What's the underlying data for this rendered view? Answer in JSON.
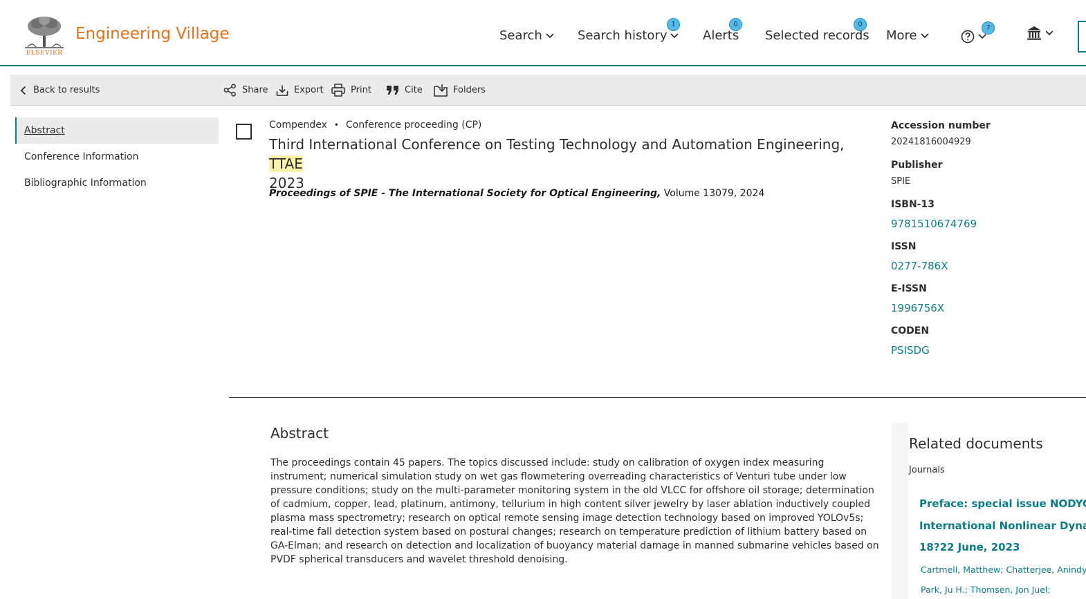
{
  "header": {
    "logo_text": "ELSEVIER",
    "brand": "Engineering Village",
    "nav": [
      {
        "label": "Search",
        "badge": ""
      },
      {
        "label": "Search history",
        "badge": "1"
      },
      {
        "label": "Alerts",
        "badge": "0"
      },
      {
        "label": "Selected records",
        "badge": "0"
      },
      {
        "label": "More",
        "badge": ""
      },
      {
        "label": "",
        "badge": "7"
      }
    ]
  },
  "toolbar": {
    "back": "Back to results",
    "share": "Share",
    "export": "Export",
    "print": "Print",
    "cite": "Cite",
    "folders": "Folders"
  },
  "sidebar": {
    "items": [
      {
        "label": "Abstract"
      },
      {
        "label": "Conference Information"
      },
      {
        "label": "Bibliographic Information"
      }
    ]
  },
  "record": {
    "database": "Compendex",
    "doc_type": "Conference proceeding (CP)",
    "title_main": "Third International Conference on Testing Technology and Automation Engineering, ",
    "title_highlight": "TTAE",
    "title_end": "2023",
    "source_publication": "Proceedings of SPIE - The International Society for Optical Engineering,",
    "source_rest": " Volume 13079, 2024"
  },
  "details": {
    "accession_label": "Accession number",
    "accession_value": "20241816004929",
    "publisher_label": "Publisher",
    "publisher_value": "SPIE",
    "isbn_label": "ISBN-13",
    "isbn_value": "9781510674769",
    "issn_label": "ISSN",
    "issn_value": "0277-786X",
    "eissn_label": "E-ISSN",
    "eissn_value": "1996756X",
    "coden_label": "CODEN",
    "coden_value": "PSISDG"
  },
  "abstract": {
    "heading": "Abstract",
    "body": "The proceedings contain 45 papers. The topics discussed include: study on calibration of oxygen index measuring instrument; numerical simulation study on wet gas flowmetering overreading characteristics of Venturi tube under low pressure conditions; study on the multi-parameter monitoring system in the old VLCC for offshore oil storage; determination of cadmium, copper, lead, platinum, antimony, tellurium in high content silver jewelry by laser ablation inductively coupled plasma mass spectrometry; research on optical remote sensing image detection technology based on improved YOLOv5s; real-time fall detection system based on postural changes; research on temperature prediction of lithium battery based on GA-Elman; and research on detection and localization of buoyancy material damage in manned submarine vehicles based on PVDF spherical transducers and wavelet threshold denoising."
  },
  "related": {
    "heading": "Related documents",
    "subheading": "Journals",
    "doc_title_line1": "Preface: special issue NODYCON",
    "doc_title_line2": "International Nonlinear Dynam",
    "doc_title_line3": "18?22 June, 2023",
    "authors": [
      "Cartmell, Matthew;",
      "Chatterjee, Anindya;",
      "Park, Ju H.;",
      "Thomsen, Jon Juel;"
    ]
  },
  "colors": {
    "brand_orange": "#e9711c",
    "teal": "#0c7d84",
    "badge_blue": "#53b9e5",
    "highlight": "#fff2a8"
  },
  "icons": [
    "elsevier-tree-logo",
    "chevron-down-icon",
    "help-icon",
    "institution-icon",
    "chevron-left-icon",
    "share-icon",
    "export-icon",
    "print-icon",
    "cite-icon",
    "folder-icon"
  ]
}
